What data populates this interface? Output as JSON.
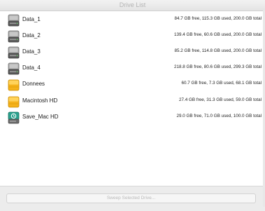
{
  "window": {
    "title": "Drive List",
    "button_label": "Sweep Selected Drive..."
  },
  "drives": [
    {
      "name": "Data_1",
      "stats": "84.7 GB free, 115.3 GB used, 200.0 GB total",
      "icon": "hard-drive-icon"
    },
    {
      "name": "Data_2",
      "stats": "139.4 GB free, 60.6 GB used, 200.0 GB total",
      "icon": "hard-drive-icon"
    },
    {
      "name": "Data_3",
      "stats": "85.2 GB free, 114.8 GB used, 200.0 GB total",
      "icon": "hard-drive-icon"
    },
    {
      "name": "Data_4",
      "stats": "218.8 GB free, 80.6 GB used, 299.3 GB total",
      "icon": "hard-drive-icon"
    },
    {
      "name": "Donnees",
      "stats": "60.7 GB free, 7.3 GB used, 68.1 GB total",
      "icon": "external-drive-icon"
    },
    {
      "name": "Macintosh HD",
      "stats": "27.4 GB free, 31.3 GB used, 59.0 GB total",
      "icon": "external-drive-icon"
    },
    {
      "name": "Save_Mac HD",
      "stats": "29.0 GB free, 71.0 GB used, 100.0 GB total",
      "icon": "time-machine-drive-icon"
    }
  ],
  "colors": {
    "external_drive": "#f2a900",
    "time_machine": "#1f8f7e",
    "internal_drive": "#8a8a8a"
  }
}
